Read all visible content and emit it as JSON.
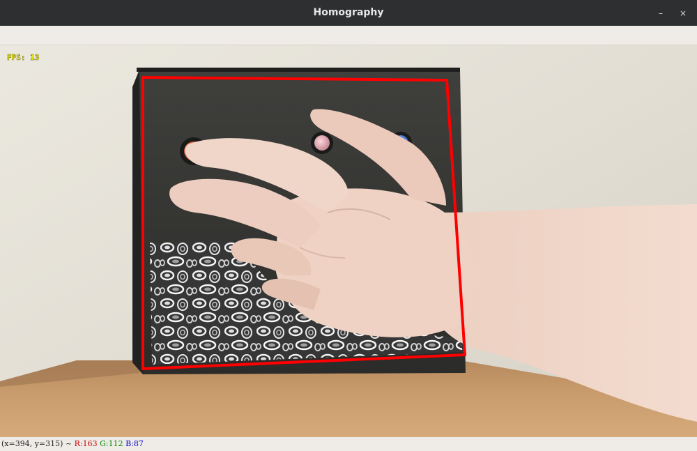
{
  "window": {
    "title": "Homography",
    "minimize_glyph": "–",
    "close_glyph": "×"
  },
  "overlay": {
    "fps_text": "FPS: 13",
    "fps_color": "#ffff00",
    "quad_color": "#ff0000"
  },
  "status": {
    "coords": "(x=394, y=315) ~ ",
    "r": "R:163",
    "g": "G:112",
    "b": "B:87",
    "r_color": "#cc0000",
    "g_color": "#008800",
    "b_color": "#0000cc"
  },
  "icons": {
    "minimize": "minimize-icon",
    "close": "close-icon"
  }
}
